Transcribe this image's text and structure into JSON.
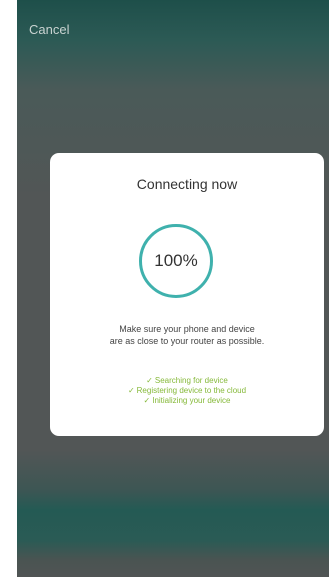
{
  "header": {
    "cancel_label": "Cancel"
  },
  "dialog": {
    "title": "Connecting now",
    "progress_text": "100%",
    "progress_fraction": 1.0,
    "note_line1": "Make sure your phone and device",
    "note_line2": "are as close to your router as possible.",
    "steps": [
      {
        "check": "✓",
        "label": "Searching for device"
      },
      {
        "check": "✓",
        "label": "Registering device to the cloud"
      },
      {
        "check": "✓",
        "label": "Initializing your device"
      }
    ]
  },
  "colors": {
    "accent": "#3fb1ad",
    "success": "#86b93a",
    "overlay": "#525656",
    "header_bg": "#1e4f4a"
  },
  "icons": {
    "step_check": "checkmark-icon"
  }
}
